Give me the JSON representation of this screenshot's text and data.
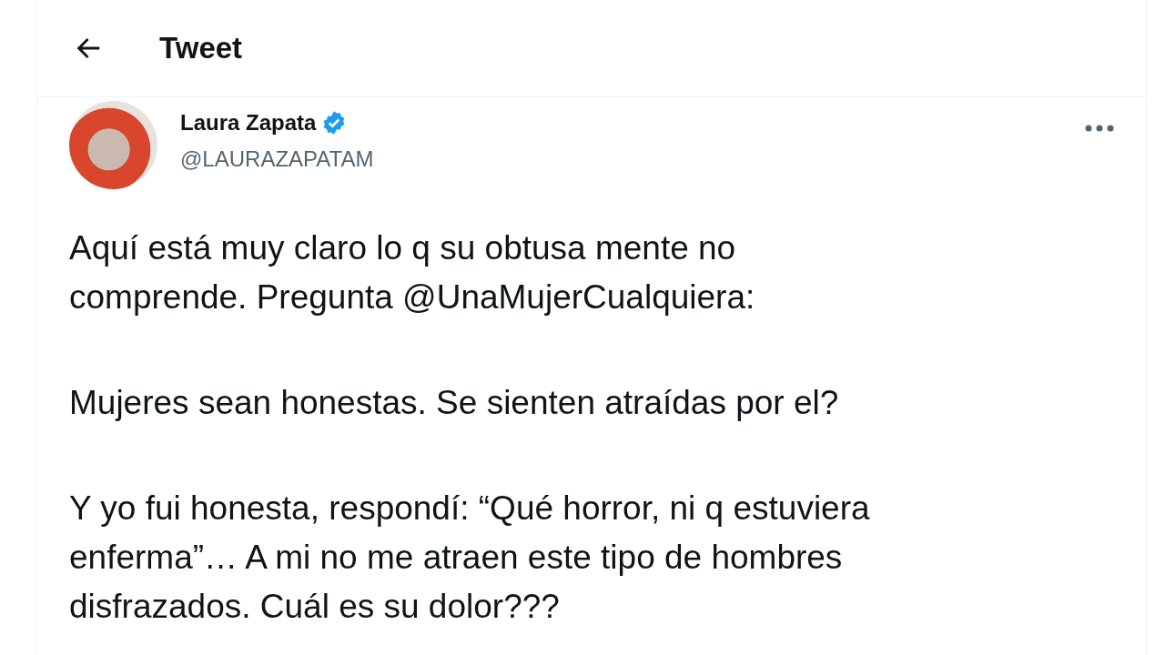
{
  "header": {
    "title": "Tweet"
  },
  "tweet": {
    "author": {
      "name": "Laura Zapata",
      "verified": true,
      "handle": "@LAURAZAPATAM"
    },
    "paragraphs": [
      "Aquí está muy claro lo q su obtusa mente no\ncomprende. Pregunta @UnaMujerCualquiera:",
      "Mujeres sean honestas. Se sienten atraídas por el?",
      "Y yo fui honesta, respondí: “Qué horror, ni q estuviera\nenferma”… A mi no me atraen este tipo de hombres\ndisfrazados. Cuál es su dolor???"
    ]
  }
}
